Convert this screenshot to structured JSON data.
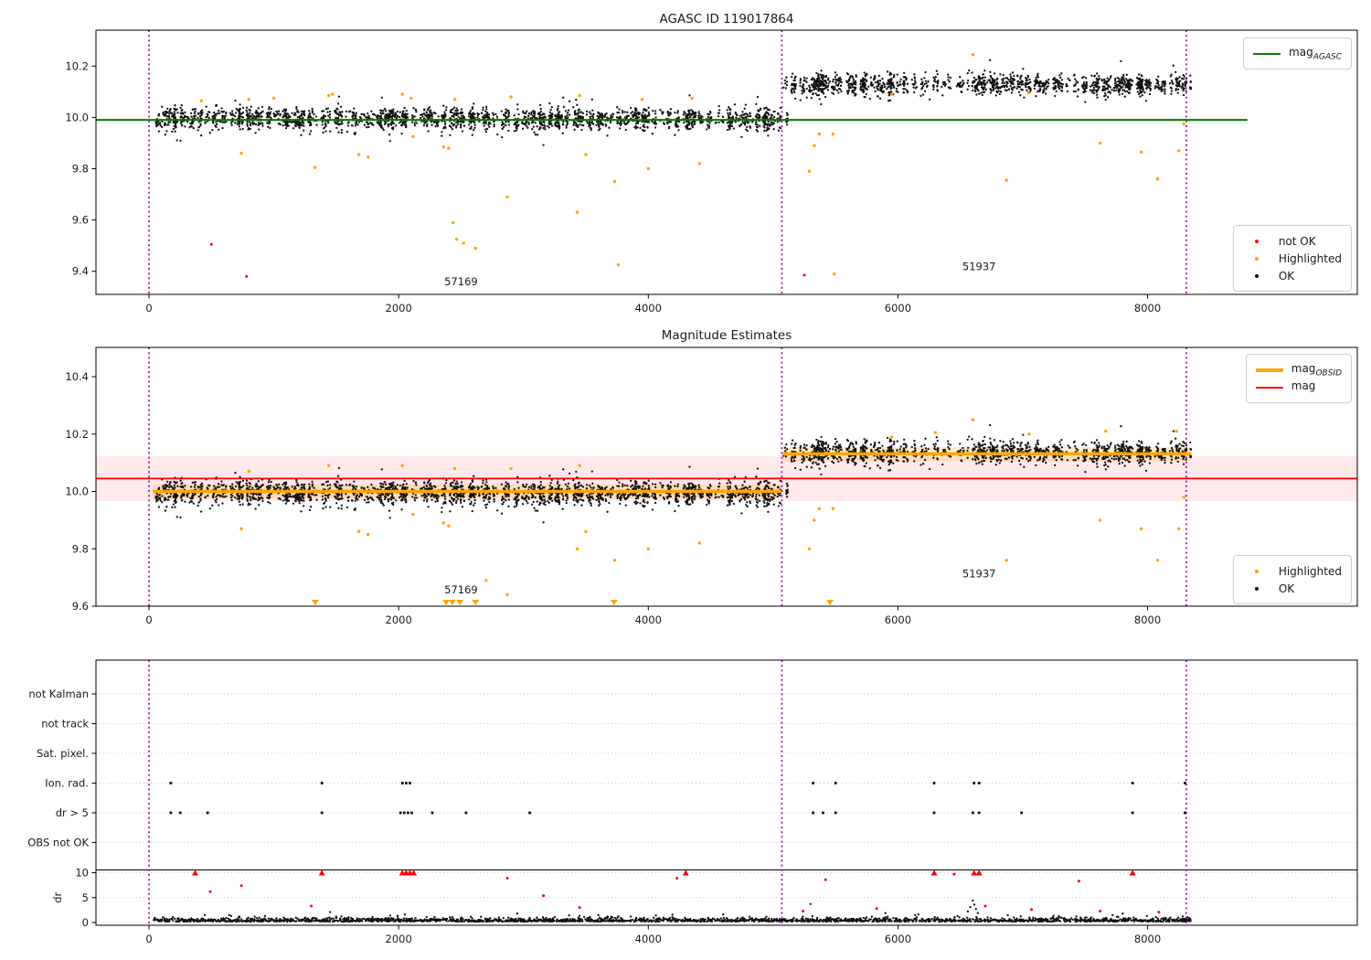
{
  "titles": {
    "top": "AGASC ID 119017864",
    "middle": "Magnitude Estimates"
  },
  "colors": {
    "mag_agasc_line": "#007f00",
    "mag_line": "#ff0000",
    "mag_band": "rgba(255,40,60,0.10)",
    "obsid_line": "#ffa500",
    "obsid_band": "rgba(255,166,0,0.22)",
    "boundary_line": "#990099",
    "ok_marker": "#111111",
    "highlighted_marker": "#ffa500",
    "not_ok_marker": "#ff0000",
    "grid_dotted": "#c8c8c8"
  },
  "legend_top_line": {
    "items": [
      {
        "main": "mag",
        "sub": "AGASC"
      }
    ]
  },
  "legend_top_markers": {
    "items": [
      {
        "label": "not OK"
      },
      {
        "label": "Highlighted"
      },
      {
        "label": "OK"
      }
    ]
  },
  "legend_mid_lines": {
    "items": [
      {
        "main": "mag",
        "sub": "OBSID"
      },
      {
        "main": "mag",
        "sub": ""
      }
    ]
  },
  "legend_mid_markers": {
    "items": [
      {
        "label": "Highlighted"
      },
      {
        "label": "OK"
      }
    ]
  },
  "chart_data": [
    {
      "type": "scatter",
      "name": "top-mag-plot",
      "title": "AGASC ID 119017864",
      "xlabel": "",
      "ylabel": "",
      "xlim": [
        -425,
        9680
      ],
      "ylim": [
        9.31,
        10.34
      ],
      "xticks": [
        0,
        2000,
        4000,
        6000,
        8000
      ],
      "yticks": [
        9.4,
        9.6,
        9.8,
        10.0,
        10.2
      ],
      "legend_position": [
        "upper right",
        "lower right"
      ],
      "ref_line": {
        "label": "mag_AGASC",
        "y": 9.99,
        "x0": -425,
        "x1": 8800
      },
      "obsid_boundaries": [
        0,
        5070,
        8310
      ],
      "ok_band_segments": [
        {
          "x0": 30,
          "x1": 5060,
          "mean": 9.995,
          "sd": 0.021,
          "seed": 11
        },
        {
          "x0": 5078,
          "x1": 8350,
          "mean": 10.127,
          "sd": 0.019,
          "seed": 23
        },
        {
          "x0": 5072,
          "x1": 5118,
          "mean": 9.99,
          "sd": 0.022,
          "seed": 5
        }
      ],
      "highlighted": [
        [
          420,
          10.065
        ],
        [
          800,
          10.07
        ],
        [
          1000,
          10.075
        ],
        [
          1440,
          10.085
        ],
        [
          1470,
          10.09
        ],
        [
          2030,
          10.09
        ],
        [
          2100,
          10.075
        ],
        [
          2450,
          10.07
        ],
        [
          2900,
          10.08
        ],
        [
          3450,
          10.085
        ],
        [
          3950,
          10.07
        ],
        [
          4350,
          10.075
        ],
        [
          740,
          9.86
        ],
        [
          1330,
          9.805
        ],
        [
          1680,
          9.855
        ],
        [
          1755,
          9.845
        ],
        [
          2115,
          9.925
        ],
        [
          2360,
          9.885
        ],
        [
          2400,
          9.88
        ],
        [
          2435,
          9.59
        ],
        [
          2465,
          9.525
        ],
        [
          2520,
          9.51
        ],
        [
          2615,
          9.49
        ],
        [
          2870,
          9.69
        ],
        [
          3430,
          9.63
        ],
        [
          3500,
          9.855
        ],
        [
          3730,
          9.75
        ],
        [
          3760,
          9.425
        ],
        [
          4000,
          9.8
        ],
        [
          4410,
          9.82
        ],
        [
          5290,
          9.79
        ],
        [
          5330,
          9.89
        ],
        [
          5370,
          9.935
        ],
        [
          5480,
          9.935
        ],
        [
          5490,
          9.39
        ],
        [
          6600,
          10.245
        ],
        [
          6870,
          9.755
        ],
        [
          7620,
          9.9
        ],
        [
          7950,
          9.865
        ],
        [
          8080,
          9.76
        ],
        [
          8250,
          9.87
        ],
        [
          8290,
          9.975
        ],
        [
          5950,
          10.09
        ],
        [
          7050,
          10.095
        ]
      ],
      "not_ok": [
        [
          500,
          9.505
        ],
        [
          780,
          9.38
        ],
        [
          5250,
          9.385
        ]
      ],
      "annotations": [
        {
          "text": "57169",
          "x": 2500,
          "y": 9.345
        },
        {
          "text": "51937",
          "x": 6650,
          "y": 9.405
        }
      ]
    },
    {
      "type": "scatter",
      "name": "middle-mag-plot",
      "title": "Magnitude Estimates",
      "xlabel": "",
      "ylabel": "",
      "xlim": [
        -425,
        9680
      ],
      "ylim": [
        9.6,
        10.502
      ],
      "xticks": [
        0,
        2000,
        4000,
        6000,
        8000
      ],
      "yticks": [
        9.6,
        9.8,
        10.0,
        10.2,
        10.4
      ],
      "legend_position": [
        "upper right",
        "lower right"
      ],
      "mag_line": {
        "label": "mag",
        "y": 10.045,
        "band": [
          9.967,
          10.122
        ],
        "x0": -425,
        "x1": 9680
      },
      "obsid_lines": [
        {
          "label": "mag_OBSID",
          "x0": 30,
          "x1": 5065,
          "y": 10.0,
          "band_halfwidth": 0.024
        },
        {
          "label": "mag_OBSID",
          "x0": 5078,
          "x1": 8350,
          "y": 10.131,
          "band_halfwidth": 0.024
        }
      ],
      "obsid_boundaries": [
        0,
        5070,
        8310
      ],
      "ok_band_segments": [
        {
          "x0": 30,
          "x1": 5060,
          "mean": 9.995,
          "sd": 0.021,
          "seed": 11
        },
        {
          "x0": 5078,
          "x1": 8350,
          "mean": 10.135,
          "sd": 0.019,
          "seed": 23
        },
        {
          "x0": 5072,
          "x1": 5118,
          "mean": 10.0,
          "sd": 0.022,
          "seed": 5
        }
      ],
      "highlighted": [
        [
          800,
          10.07
        ],
        [
          1440,
          10.09
        ],
        [
          2030,
          10.09
        ],
        [
          2450,
          10.08
        ],
        [
          2900,
          10.08
        ],
        [
          3450,
          10.09
        ],
        [
          740,
          9.87
        ],
        [
          1680,
          9.86
        ],
        [
          1755,
          9.85
        ],
        [
          2115,
          9.92
        ],
        [
          2360,
          9.89
        ],
        [
          2400,
          9.88
        ],
        [
          2700,
          9.69
        ],
        [
          2870,
          9.64
        ],
        [
          3430,
          9.8
        ],
        [
          3500,
          9.86
        ],
        [
          3730,
          9.76
        ],
        [
          4000,
          9.8
        ],
        [
          4410,
          9.82
        ],
        [
          5290,
          9.8
        ],
        [
          5330,
          9.9
        ],
        [
          5370,
          9.94
        ],
        [
          5480,
          9.94
        ],
        [
          6600,
          10.25
        ],
        [
          6870,
          9.76
        ],
        [
          7620,
          9.9
        ],
        [
          7950,
          9.87
        ],
        [
          8080,
          9.76
        ],
        [
          8250,
          9.87
        ],
        [
          8290,
          9.98
        ],
        [
          6300,
          10.205
        ],
        [
          7665,
          10.21
        ],
        [
          8230,
          10.21
        ],
        [
          5950,
          10.19
        ],
        [
          7050,
          10.2
        ]
      ],
      "clipped_low_x": [
        1332,
        2380,
        2430,
        2490,
        2615,
        3725,
        5455
      ],
      "annotations": [
        {
          "text": "57169",
          "x": 2500,
          "y": 9.645
        },
        {
          "text": "51937",
          "x": 6650,
          "y": 9.7
        }
      ]
    },
    {
      "type": "flags",
      "name": "flags-dr-plot",
      "xlabel": "",
      "ylabel": "dr",
      "xlim": [
        -425,
        9680
      ],
      "xticks": [
        0,
        2000,
        4000,
        6000,
        8000
      ],
      "categories": [
        "not Kalman",
        "not track",
        "Sat. pixel.",
        "Ion. rad.",
        "dr > 5",
        "OBS not OK"
      ],
      "dr_ticks": [
        0,
        5,
        10
      ],
      "dr_divider": 10.55,
      "obsid_boundaries": [
        0,
        5070,
        8310
      ],
      "flag_points": {
        "not Kalman": [],
        "not track": [],
        "Sat. pixel.": [],
        "Ion. rad.": [
          175,
          1385,
          2030,
          2060,
          2090,
          5320,
          5500,
          6290,
          6610,
          6650,
          7880,
          8300
        ],
        "dr > 5": [
          175,
          250,
          470,
          1385,
          2015,
          2045,
          2075,
          2105,
          2270,
          2540,
          3050,
          5320,
          5400,
          5500,
          6290,
          6600,
          6650,
          6990,
          7880,
          8300
        ],
        "OBS not OK": []
      },
      "dr_band": {
        "x0": 30,
        "x1": 8350,
        "base": 0.55,
        "seed": 77
      },
      "dr_black_extra": [
        [
          6560,
          2.2
        ],
        [
          6580,
          3.1
        ],
        [
          6600,
          4.4
        ],
        [
          6612,
          3.6
        ],
        [
          6625,
          2.7
        ],
        [
          6640,
          1.9
        ],
        [
          1450,
          2.1
        ],
        [
          5300,
          3.7
        ],
        [
          5900,
          1.9
        ],
        [
          7800,
          1.8
        ],
        [
          2050,
          1.6
        ],
        [
          3600,
          1.5
        ],
        [
          4600,
          1.6
        ],
        [
          2950,
          1.8
        ]
      ],
      "dr_red_points": [
        [
          490,
          6.2
        ],
        [
          740,
          7.4
        ],
        [
          1300,
          3.3
        ],
        [
          2870,
          8.9
        ],
        [
          3160,
          5.4
        ],
        [
          3450,
          3.0
        ],
        [
          4230,
          8.9
        ],
        [
          5240,
          2.3
        ],
        [
          5420,
          8.6
        ],
        [
          5830,
          2.8
        ],
        [
          6450,
          9.7
        ],
        [
          6700,
          3.3
        ],
        [
          7070,
          2.6
        ],
        [
          7450,
          8.3
        ],
        [
          7620,
          2.3
        ],
        [
          8090,
          2.1
        ]
      ],
      "dr_red_clipped_x": [
        370,
        1385,
        2030,
        2060,
        2090,
        2120,
        4300,
        6290,
        6610,
        6650,
        7880
      ]
    }
  ]
}
